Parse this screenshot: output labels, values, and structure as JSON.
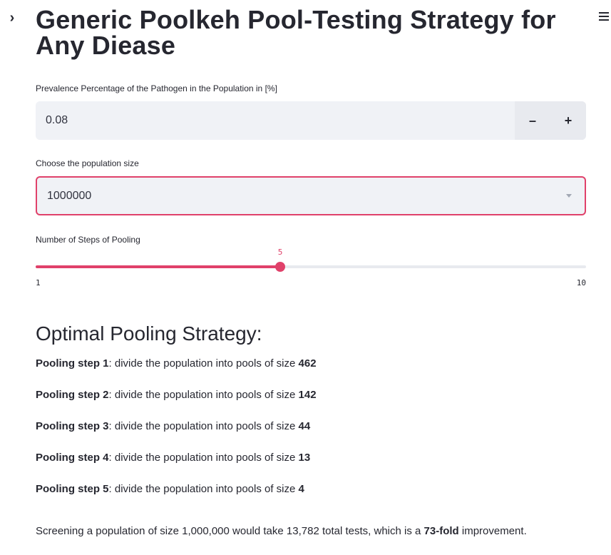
{
  "header": {
    "sidebar_toggle_glyph": "›",
    "title": "Generic Poolkeh Pool-Testing Strategy for Any Diease",
    "menu_icon": "hamburger-menu-icon"
  },
  "prevalence": {
    "label": "Prevalence Percentage of the Pathogen in the Population in [%]",
    "value": "0.08",
    "minus_label": "–",
    "plus_label": "+"
  },
  "population": {
    "label": "Choose the population size",
    "selected": "1000000"
  },
  "pooling_steps": {
    "label": "Number of Steps of Pooling",
    "current": "5",
    "min": "1",
    "max": "10",
    "colors": {
      "accent": "#e0416a",
      "track": "#e8eaef"
    }
  },
  "strategy": {
    "title": "Optimal Pooling Strategy:",
    "steps": [
      {
        "label": "Pooling step 1",
        "text": ": divide the population into pools of size ",
        "size": "462"
      },
      {
        "label": "Pooling step 2",
        "text": ": divide the population into pools of size ",
        "size": "142"
      },
      {
        "label": "Pooling step 3",
        "text": ": divide the population into pools of size ",
        "size": "44"
      },
      {
        "label": "Pooling step 4",
        "text": ": divide the population into pools of size ",
        "size": "13"
      },
      {
        "label": "Pooling step 5",
        "text": ": divide the population into pools of size ",
        "size": "4"
      }
    ],
    "summary_prefix": "Screening a population of size 1,000,000 would take 13,782 total tests, which is a ",
    "summary_bold": "73-fold",
    "summary_suffix": " improvement."
  }
}
